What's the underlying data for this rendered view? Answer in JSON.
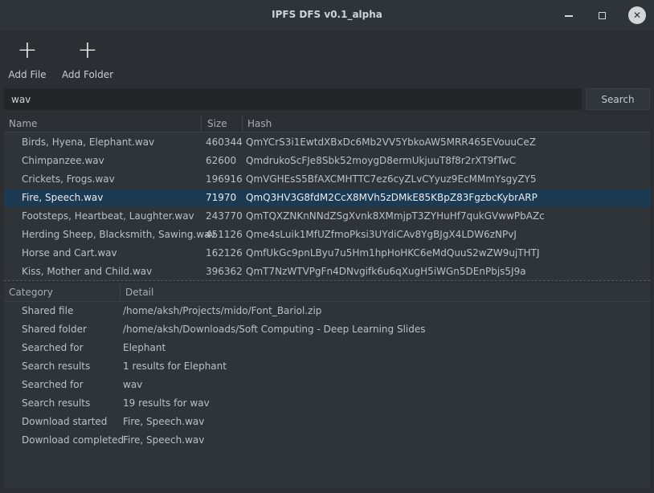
{
  "window": {
    "title": "IPFS DFS v0.1_alpha",
    "minimize_icon": "minimize-icon",
    "maximize_icon": "maximize-icon",
    "close_icon": "close-icon",
    "close_glyph": "✕"
  },
  "toolbar": {
    "add_file": {
      "icon": "plus-icon",
      "glyph": "+",
      "label": "Add File"
    },
    "add_folder": {
      "icon": "plus-icon",
      "glyph": "+",
      "label": "Add Folder"
    }
  },
  "search": {
    "value": "wav",
    "button_label": "Search"
  },
  "files": {
    "columns": {
      "name": "Name",
      "size": "Size",
      "hash": "Hash"
    },
    "selected_index": 3,
    "rows": [
      {
        "name": "Birds, Hyena, Elephant.wav",
        "size": "460344",
        "hash": "QmYCrS3i1EwtdXBxDc6Mb2VV5YbkoAW5MRR465EVouuCeZ"
      },
      {
        "name": "Chimpanzee.wav",
        "size": "62600",
        "hash": "QmdrukoScFJe8Sbk52moygD8ermUkjuuT8f8r2rXT9fTwC"
      },
      {
        "name": "Crickets, Frogs.wav",
        "size": "196916",
        "hash": "QmVGHEsS5BfAXCMHTTC7ez6cyZLvCYyuz9EcMMmYsgyZY5"
      },
      {
        "name": "Fire, Speech.wav",
        "size": "71970",
        "hash": "QmQ3HV3G8fdM2CcX8MVh5zDMkE85KBpZ83FgzbcKybrARP"
      },
      {
        "name": "Footsteps, Heartbeat, Laughter.wav",
        "size": "243770",
        "hash": "QmTQXZNKnNNdZSgXvnk8XMmjpT3ZYHuHf7qukGVwwPbAZc"
      },
      {
        "name": "Herding Sheep, Blacksmith, Sawing.wav",
        "size": "451126",
        "hash": "Qme4sLuik1MfUZfmoPksi3UYdiCAv8YgBJgX4LDW6zNPvJ"
      },
      {
        "name": "Horse and Cart.wav",
        "size": "162126",
        "hash": "QmfUkGc9pnLByu7u5Hm1hpHoHKC6eMdQuuS2wZW9ujTHTJ"
      },
      {
        "name": "Kiss, Mother and Child.wav",
        "size": "396362",
        "hash": "QmT7NzWTVPgFn4DNvgifk6u6qXugH5iWGn5DEnPbjs5J9a"
      }
    ]
  },
  "log": {
    "columns": {
      "category": "Category",
      "detail": "Detail"
    },
    "rows": [
      {
        "category": "Shared file",
        "detail": "/home/aksh/Projects/mido/Font_Bariol.zip"
      },
      {
        "category": "Shared folder",
        "detail": "/home/aksh/Downloads/Soft Computing - Deep Learning Slides"
      },
      {
        "category": "Searched for",
        "detail": "Elephant"
      },
      {
        "category": "Search results",
        "detail": "1 results for Elephant"
      },
      {
        "category": "Searched for",
        "detail": "wav"
      },
      {
        "category": "Search results",
        "detail": "19 results for wav"
      },
      {
        "category": "Download started",
        "detail": "Fire, Speech.wav"
      },
      {
        "category": "Download completed",
        "detail": "Fire, Speech.wav"
      }
    ]
  },
  "colors": {
    "background": "#2b2f33",
    "panel": "#2f3438",
    "selection": "#1d3a53"
  }
}
